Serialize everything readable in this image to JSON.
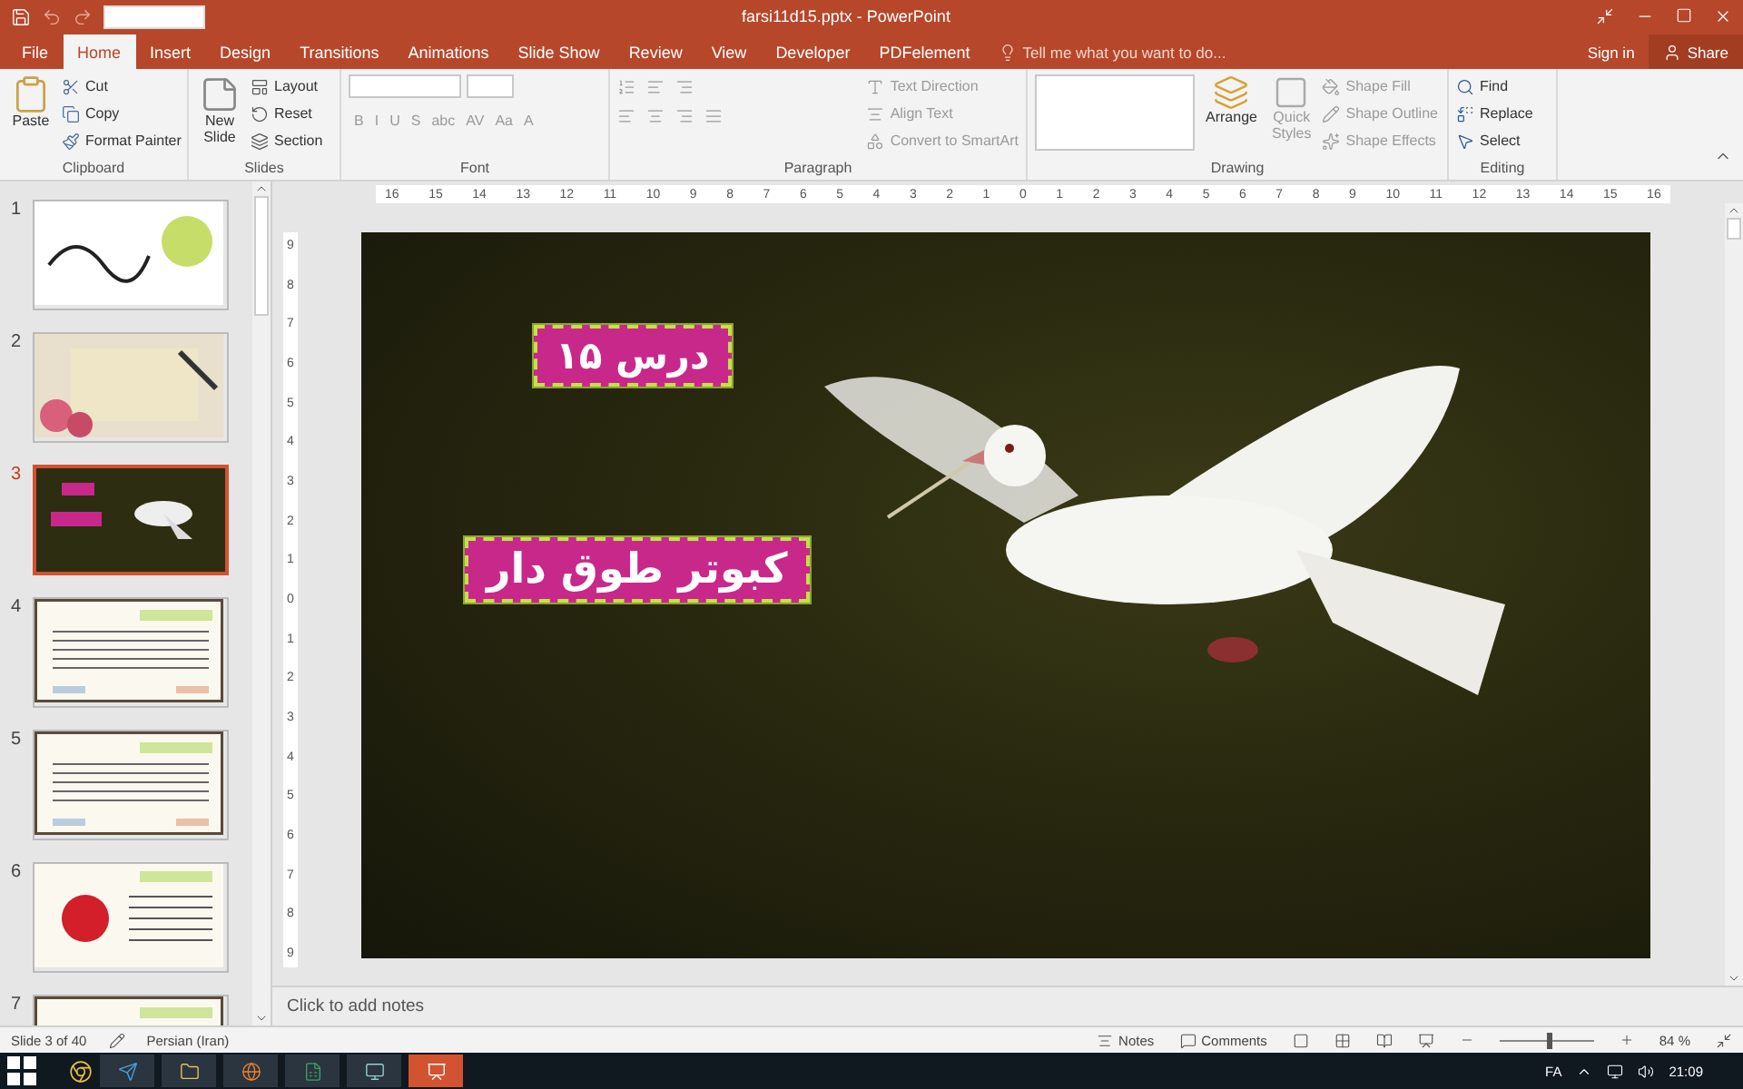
{
  "window": {
    "title": "farsi11d15.pptx - PowerPoint"
  },
  "tabs": [
    {
      "label": "File",
      "selected": false
    },
    {
      "label": "Home",
      "selected": true
    },
    {
      "label": "Insert",
      "selected": false
    },
    {
      "label": "Design",
      "selected": false
    },
    {
      "label": "Transitions",
      "selected": false
    },
    {
      "label": "Animations",
      "selected": false
    },
    {
      "label": "Slide Show",
      "selected": false
    },
    {
      "label": "Review",
      "selected": false
    },
    {
      "label": "View",
      "selected": false
    },
    {
      "label": "Developer",
      "selected": false
    },
    {
      "label": "PDFelement",
      "selected": false
    }
  ],
  "tell_me": {
    "placeholder": "Tell me what you want to do..."
  },
  "account": {
    "sign_in": "Sign in",
    "share": "Share"
  },
  "ribbon": {
    "clipboard": {
      "title": "Clipboard",
      "paste": "Paste",
      "items": [
        "Cut",
        "Copy",
        "Format Painter"
      ]
    },
    "slides": {
      "title": "Slides",
      "new_slide": [
        "New",
        "Slide"
      ],
      "items": [
        "Layout",
        "Reset",
        "Section"
      ]
    },
    "font": {
      "title": "Font",
      "buttons": [
        "B",
        "I",
        "U",
        "S",
        "abc",
        "AV",
        "Aa",
        "A"
      ]
    },
    "paragraph": {
      "title": "Paragraph",
      "items": [
        "Text Direction",
        "Align Text",
        "Convert to SmartArt"
      ]
    },
    "drawing": {
      "title": "Drawing",
      "arrange": "Arrange",
      "quick_styles": [
        "Quick",
        "Styles"
      ],
      "items": [
        "Shape Fill",
        "Shape Outline",
        "Shape Effects"
      ]
    },
    "editing": {
      "title": "Editing",
      "items": [
        "Find",
        "Replace",
        "Select"
      ]
    }
  },
  "horizontal_ruler": [
    "16",
    "15",
    "14",
    "13",
    "12",
    "11",
    "10",
    "9",
    "8",
    "7",
    "6",
    "5",
    "4",
    "3",
    "2",
    "1",
    "0",
    "1",
    "2",
    "3",
    "4",
    "5",
    "6",
    "7",
    "8",
    "9",
    "10",
    "11",
    "12",
    "13",
    "14",
    "15",
    "16"
  ],
  "vertical_ruler": [
    "9",
    "8",
    "7",
    "6",
    "5",
    "4",
    "3",
    "2",
    "1",
    "0",
    "1",
    "2",
    "3",
    "4",
    "5",
    "6",
    "7",
    "8",
    "9"
  ],
  "thumbnails": [
    {
      "number": "1",
      "selected": false,
      "kind": "calligraphy"
    },
    {
      "number": "2",
      "selected": false,
      "kind": "paper"
    },
    {
      "number": "3",
      "selected": true,
      "kind": "dove"
    },
    {
      "number": "4",
      "selected": false,
      "kind": "text"
    },
    {
      "number": "5",
      "selected": false,
      "kind": "text"
    },
    {
      "number": "6",
      "selected": false,
      "kind": "flower"
    },
    {
      "number": "7",
      "selected": false,
      "kind": "text"
    }
  ],
  "slide": {
    "labels": [
      "درس ۱۵",
      "کبوتر طوق دار"
    ]
  },
  "notes": {
    "placeholder": "Click to add notes"
  },
  "status_bar": {
    "slide": "Slide 3 of 40",
    "language": "Persian (Iran)",
    "notes": "Notes",
    "comments": "Comments",
    "zoom": "84 %",
    "zoom_slider": {
      "level": 0.52
    }
  },
  "taskbar": {
    "language": "FA",
    "time": "21:09"
  }
}
